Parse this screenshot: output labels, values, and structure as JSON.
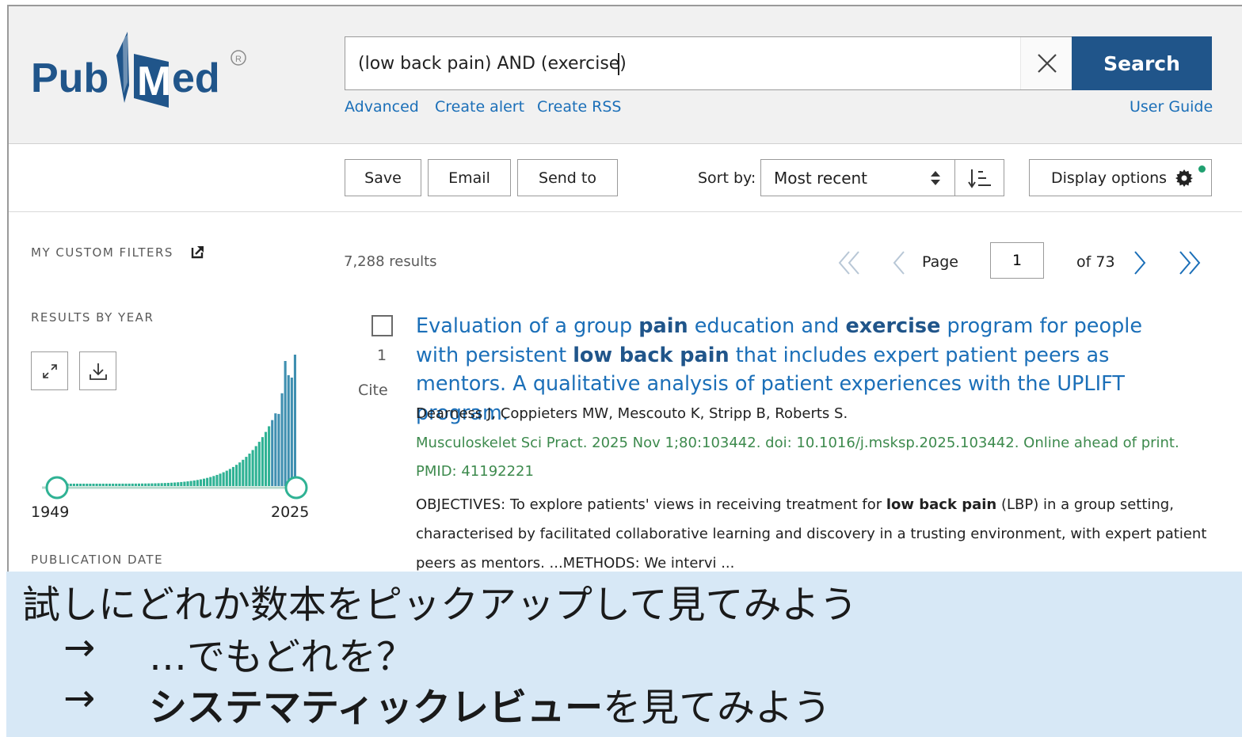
{
  "header": {
    "logo_text": "PubMed",
    "search_query": "(low back pain) AND (exercise)",
    "search_button": "Search",
    "links": [
      "Advanced",
      "Create alert",
      "Create RSS"
    ],
    "user_guide": "User Guide"
  },
  "toolbar": {
    "save": "Save",
    "email": "Email",
    "send_to": "Send to",
    "sort_label": "Sort by:",
    "sort_value": "Most recent",
    "display_options": "Display options"
  },
  "sidebar": {
    "custom_filters": "MY CUSTOM FILTERS",
    "results_by_year": "RESULTS BY YEAR",
    "year_start": "1949",
    "year_end": "2025",
    "publication_date": "PUBLICATION DATE"
  },
  "results": {
    "count": "7,288 results",
    "page_label": "Page",
    "page_value": "1",
    "page_of": "of 73",
    "item": {
      "number": "1",
      "cite": "Cite",
      "title_parts": [
        {
          "text": "Evaluation of a group ",
          "bold": false
        },
        {
          "text": "pain",
          "bold": true
        },
        {
          "text": " education and ",
          "bold": false
        },
        {
          "text": "exercise",
          "bold": true
        },
        {
          "text": " program for people with persistent ",
          "bold": false
        },
        {
          "text": "low back pain",
          "bold": true
        },
        {
          "text": " that includes expert patient peers as mentors. A qualitative analysis of patient experiences with the UPLIFT program.",
          "bold": false
        }
      ],
      "authors": "Dearness J, Coppieters MW, Mescouto K, Stripp B, Roberts S.",
      "citation": "Musculoskelet Sci Pract. 2025 Nov 1;80:103442. doi: 10.1016/j.msksp.2025.103442. Online ahead of print.",
      "pmid": "PMID: 41192221",
      "snippet_parts": [
        {
          "text": "OBJECTIVES: To explore patients' views in receiving treatment for ",
          "bold": false
        },
        {
          "text": "low back pain",
          "bold": true
        },
        {
          "text": " (LBP) in a group setting, characterised by facilitated collaborative learning and discovery in a trusting environment, with expert patient peers as mentors. ...METHODS: We intervi ...",
          "bold": false
        }
      ]
    }
  },
  "overlay": {
    "line1": "試しにどれか数本をピックアップして見てみよう",
    "line2_arrow": "→",
    "line2_text": "…でもどれを？",
    "line3_arrow": "→",
    "line3_bold": "システマティックレビュー",
    "line3_rest": "を見てみよう"
  },
  "colors": {
    "brand_blue": "#20558a",
    "link_blue": "#1b6fb8",
    "citation_green": "#3d8a4d",
    "histogram_teal": "#2fb294",
    "overlay_bg": "#d7e8f6"
  }
}
